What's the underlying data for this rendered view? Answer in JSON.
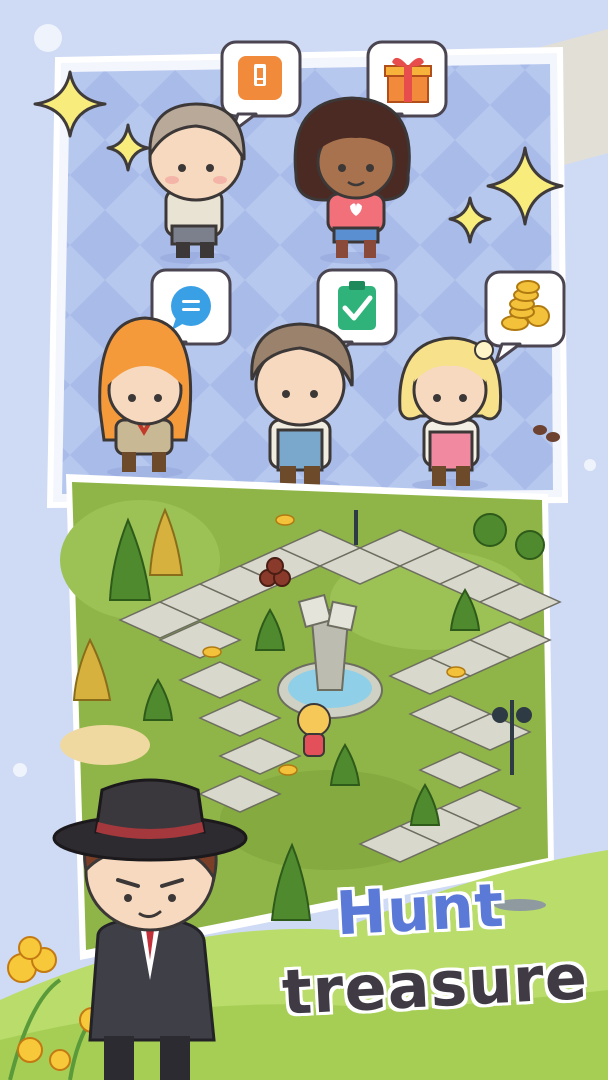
{
  "headline": {
    "line1": "Hunt",
    "line2": "treasure"
  },
  "colors": {
    "accent_blue": "#5b79d6",
    "dark_text": "#3f3a44",
    "background_lavender": "#c9d6f2",
    "board_grass": "#8fb548",
    "bubble_orange": "#f28a3b",
    "bubble_blue": "#3aa0e6",
    "bubble_green": "#2fb37a"
  },
  "characters": [
    {
      "name": "grey-haired-boy",
      "bubble_icon": "alert-clipboard-icon"
    },
    {
      "name": "dark-haired-girl",
      "bubble_icon": "gift-box-icon"
    },
    {
      "name": "orange-haired-girl",
      "bubble_icon": "chat-icon"
    },
    {
      "name": "brown-haired-boy",
      "bubble_icon": "checklist-icon"
    },
    {
      "name": "blonde-girl",
      "bubble_icon": "coins-icon"
    }
  ],
  "detective": {
    "name": "detective-mascot",
    "hat_icon": "top-hat-icon"
  }
}
